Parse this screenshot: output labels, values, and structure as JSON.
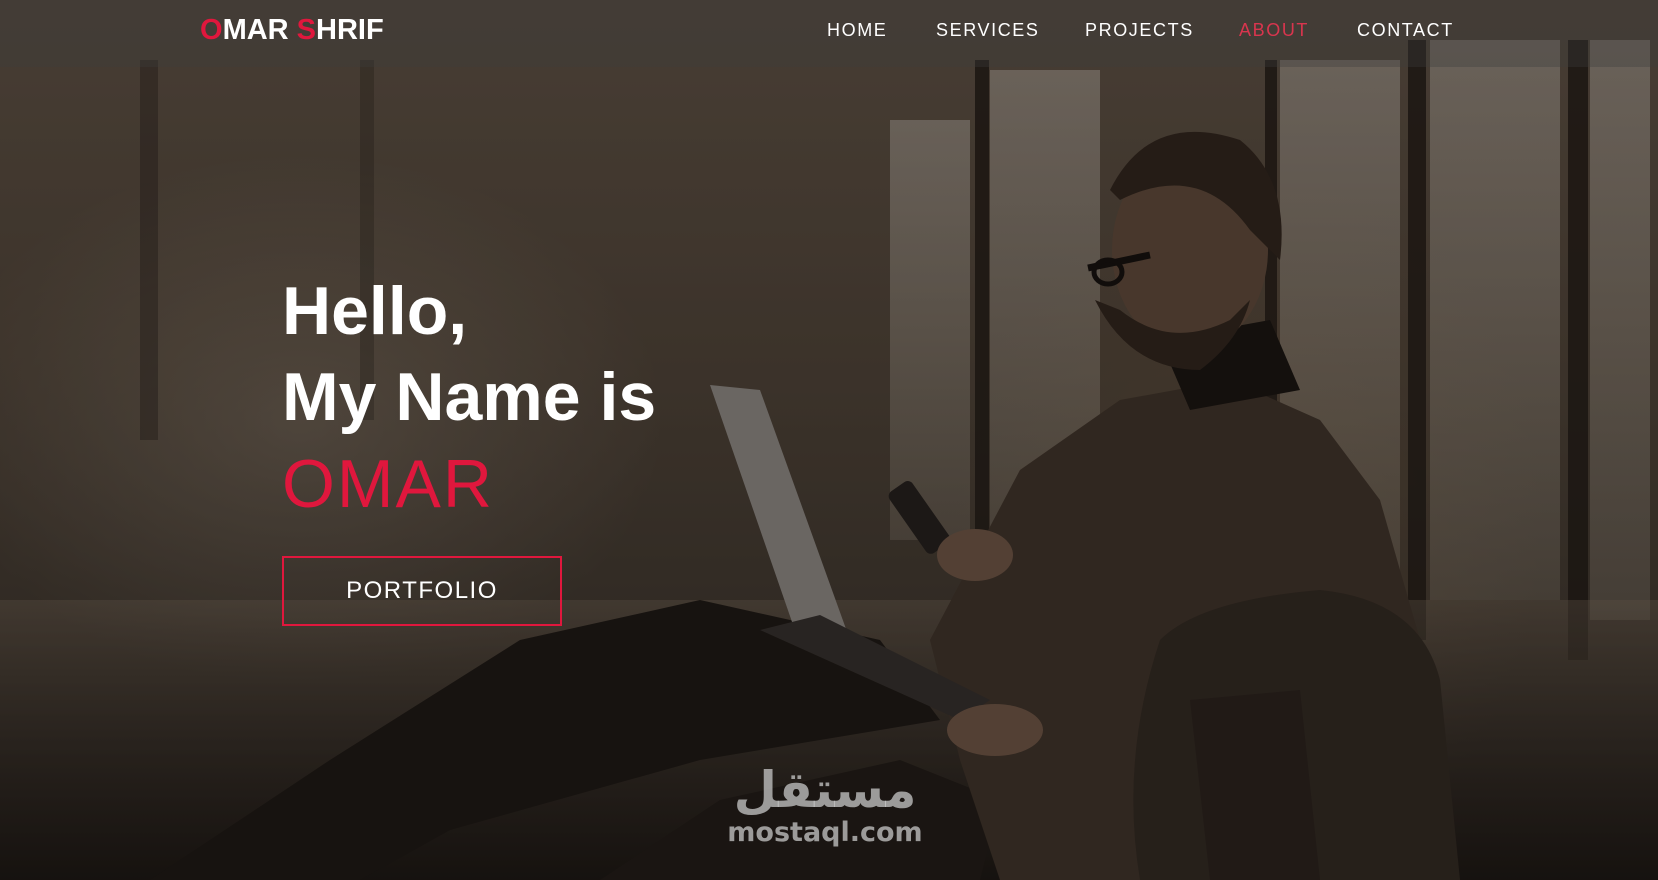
{
  "logo": {
    "first_initial": "O",
    "first_rest": "MAR ",
    "last_initial": "S",
    "last_rest": "HRIF"
  },
  "nav": {
    "items": [
      {
        "label": "HOME"
      },
      {
        "label": "SERVICES"
      },
      {
        "label": "PROJECTS"
      },
      {
        "label": "ABOUT",
        "active": true
      },
      {
        "label": "CONTACT"
      }
    ]
  },
  "hero": {
    "greeting_line1": "Hello,",
    "greeting_line2": "My Name is",
    "name": "OMAR",
    "button_label": "PORTFOLIO"
  },
  "watermark": {
    "arabic": "مستقل",
    "latin": "mostaql.com"
  },
  "colors": {
    "accent": "#e0173d",
    "active_nav": "#d9354e",
    "text": "#ffffff"
  }
}
